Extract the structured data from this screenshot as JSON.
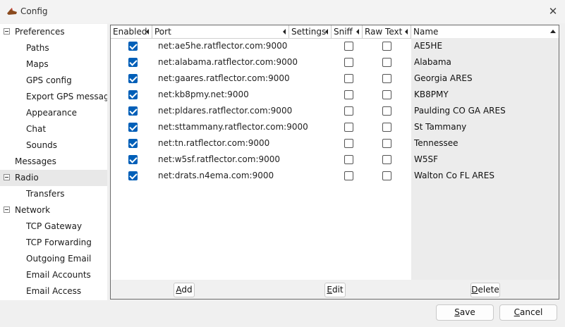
{
  "window": {
    "title": "Config",
    "close_glyph": "✕",
    "app_icon": "app-logo-icon"
  },
  "tree": {
    "items": [
      {
        "label": "Preferences",
        "level": 0,
        "expander": true,
        "selected": false
      },
      {
        "label": "Paths",
        "level": 1,
        "expander": false,
        "selected": false
      },
      {
        "label": "Maps",
        "level": 1,
        "expander": false,
        "selected": false
      },
      {
        "label": "GPS config",
        "level": 1,
        "expander": false,
        "selected": false
      },
      {
        "label": "Export GPS messages",
        "level": 1,
        "expander": false,
        "selected": false
      },
      {
        "label": "Appearance",
        "level": 1,
        "expander": false,
        "selected": false
      },
      {
        "label": "Chat",
        "level": 1,
        "expander": false,
        "selected": false
      },
      {
        "label": "Sounds",
        "level": 1,
        "expander": false,
        "selected": false
      },
      {
        "label": "Messages",
        "level": 0,
        "expander": false,
        "selected": false
      },
      {
        "label": "Radio",
        "level": 0,
        "expander": true,
        "selected": true
      },
      {
        "label": "Transfers",
        "level": 1,
        "expander": false,
        "selected": false
      },
      {
        "label": "Network",
        "level": 0,
        "expander": true,
        "selected": false
      },
      {
        "label": "TCP Gateway",
        "level": 1,
        "expander": false,
        "selected": false
      },
      {
        "label": "TCP Forwarding",
        "level": 1,
        "expander": false,
        "selected": false
      },
      {
        "label": "Outgoing Email",
        "level": 1,
        "expander": false,
        "selected": false
      },
      {
        "label": "Email Accounts",
        "level": 1,
        "expander": false,
        "selected": false
      },
      {
        "label": "Email Access",
        "level": 1,
        "expander": false,
        "selected": false
      }
    ]
  },
  "grid": {
    "columns": {
      "enabled": "Enabled",
      "port": "Port",
      "settings": "Settings",
      "sniff": "Sniff",
      "raw_text": "Raw Text",
      "name": "Name"
    },
    "rows": [
      {
        "enabled": true,
        "port": "net:ae5he.ratflector.com:9000",
        "sniff": false,
        "raw_text": false,
        "name": "AE5HE"
      },
      {
        "enabled": true,
        "port": "net:alabama.ratflector.com:9000",
        "sniff": false,
        "raw_text": false,
        "name": "Alabama"
      },
      {
        "enabled": true,
        "port": "net:gaares.ratflector.com:9000",
        "sniff": false,
        "raw_text": false,
        "name": "Georgia ARES"
      },
      {
        "enabled": true,
        "port": "net:kb8pmy.net:9000",
        "sniff": false,
        "raw_text": false,
        "name": "KB8PMY"
      },
      {
        "enabled": true,
        "port": "net:pldares.ratflector.com:9000",
        "sniff": false,
        "raw_text": false,
        "name": "Paulding CO GA ARES"
      },
      {
        "enabled": true,
        "port": "net:sttammany.ratflector.com:9000",
        "sniff": false,
        "raw_text": false,
        "name": "St Tammany"
      },
      {
        "enabled": true,
        "port": "net:tn.ratflector.com:9000",
        "sniff": false,
        "raw_text": false,
        "name": "Tennessee"
      },
      {
        "enabled": true,
        "port": "net:w5sf.ratflector.com:9000",
        "sniff": false,
        "raw_text": false,
        "name": "W5SF"
      },
      {
        "enabled": true,
        "port": "net:drats.n4ema.com:9000",
        "sniff": false,
        "raw_text": false,
        "name": "Walton Co FL ARES"
      }
    ]
  },
  "grid_buttons": {
    "add": {
      "mnemonic": "A",
      "rest": "dd"
    },
    "edit": {
      "mnemonic": "E",
      "rest": "dit"
    },
    "delete": {
      "mnemonic": "D",
      "rest": "elete"
    }
  },
  "dialog_buttons": {
    "save": {
      "mnemonic": "S",
      "rest": "ave"
    },
    "cancel": {
      "mnemonic": "C",
      "rest": "ancel"
    }
  },
  "colors": {
    "checkbox_checked": "#005fb8",
    "selection": "#e8e8e8",
    "name_column_bg": "#ececec"
  }
}
